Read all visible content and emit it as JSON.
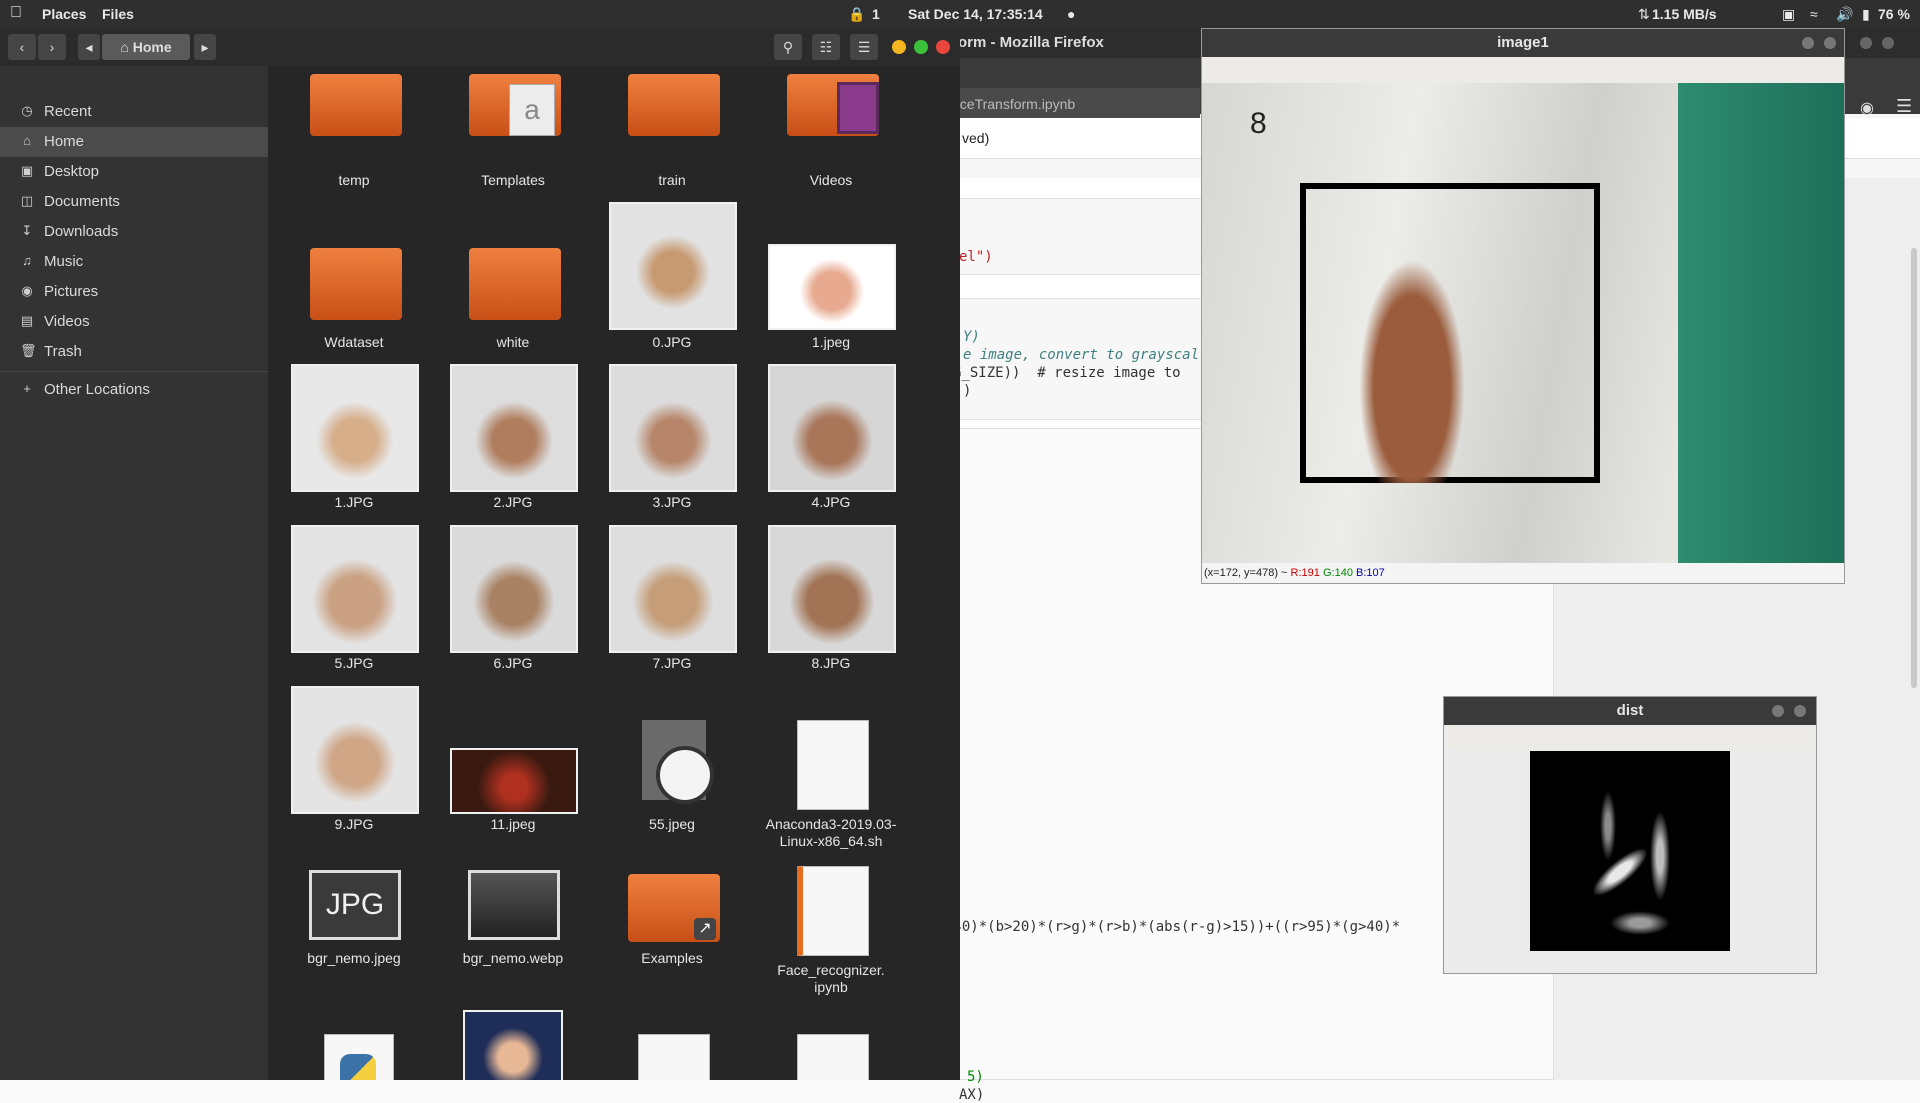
{
  "topbar": {
    "apple_icon": "apple-icon",
    "menu_places": "Places",
    "menu_files": "Files",
    "lock_count": "1",
    "datetime": "Sat Dec 14, 17:35:14",
    "net_speed": "1.15 MB/s",
    "battery": "76 %"
  },
  "firefox": {
    "title": "orm - Mozilla Firefox",
    "tab_label": "nceTransform.ipynb",
    "saved_text": "ved)",
    "code_lines": {
      "l1": "el\")",
      "l2": "Y)",
      "l3": "e image, convert to grayscal",
      "l4": "G_SIZE))  # resize image to",
      "l5": ")",
      "l6": "+40)*(b>20)*(r>g)*(r>b)*(abs(r-g)>15))+((r>95)*(g>40)*",
      "l7": "5)",
      "l8": "AX)"
    }
  },
  "file_manager": {
    "breadcrumb_home": "Home",
    "sidebar": [
      {
        "label": "Recent",
        "icon": "clock-icon"
      },
      {
        "label": "Home",
        "icon": "home-icon"
      },
      {
        "label": "Desktop",
        "icon": "folder-icon"
      },
      {
        "label": "Documents",
        "icon": "document-icon"
      },
      {
        "label": "Downloads",
        "icon": "download-icon"
      },
      {
        "label": "Music",
        "icon": "music-icon"
      },
      {
        "label": "Pictures",
        "icon": "camera-icon"
      },
      {
        "label": "Videos",
        "icon": "film-icon"
      },
      {
        "label": "Trash",
        "icon": "trash-icon"
      },
      {
        "label": "Other Locations",
        "icon": "plus-icon"
      }
    ],
    "files": {
      "temp": "temp",
      "templates": "Templates",
      "train": "train",
      "videos": "Videos",
      "wdataset": "Wdataset",
      "white": "white",
      "f0jpg": "0.JPG",
      "f1jpeg": "1.jpeg",
      "f1jpg": "1.JPG",
      "f2jpg": "2.JPG",
      "f3jpg": "3.JPG",
      "f4jpg": "4.JPG",
      "f5jpg": "5.JPG",
      "f6jpg": "6.JPG",
      "f7jpg": "7.JPG",
      "f8jpg": "8.JPG",
      "f9jpg": "9.JPG",
      "f11jpeg": "11.jpeg",
      "f55jpeg": "55.jpeg",
      "anaconda1": "Anaconda3-2019.03-",
      "anaconda2": "Linux-x86_64.sh",
      "bgr_jpeg": "bgr_nemo.jpeg",
      "bgr_webp": "bgr_nemo.webp",
      "examples": "Examples",
      "face1": "Face_recognizer.",
      "face2": "ipynb",
      "jpg_badge": "JPG"
    }
  },
  "image1": {
    "title": "image1",
    "digit": "8",
    "status_coords": "(x=172, y=478) ~",
    "status_r": "R:191",
    "status_g": "G:140",
    "status_b": "B:107"
  },
  "dist": {
    "title": "dist"
  }
}
